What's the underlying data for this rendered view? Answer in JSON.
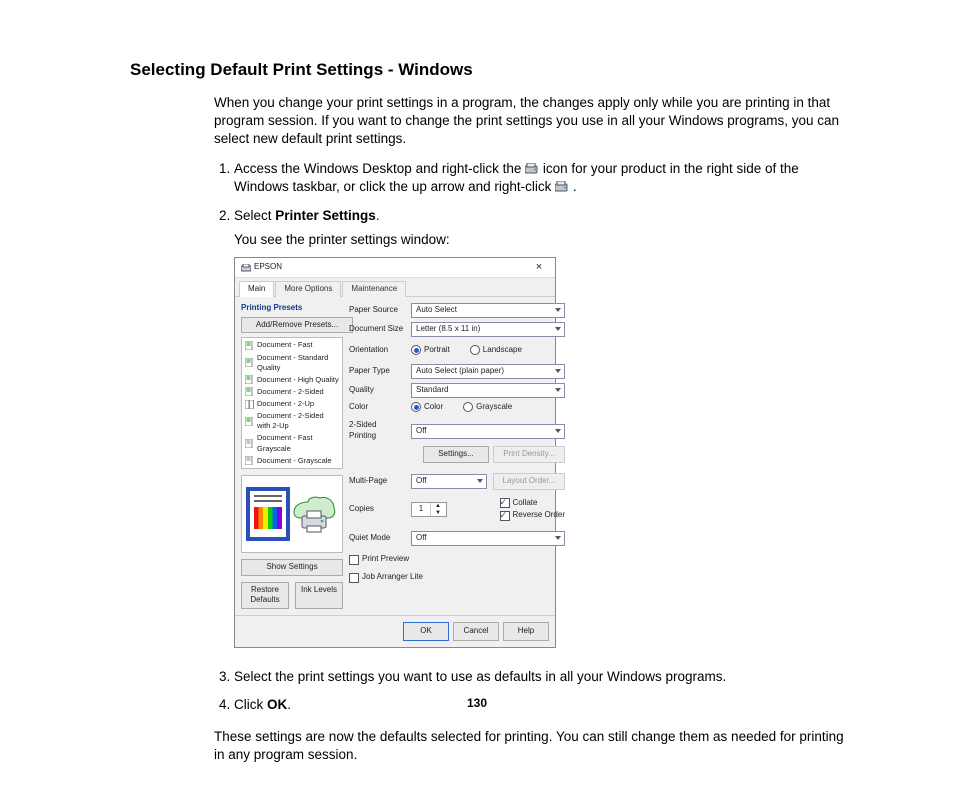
{
  "title": "Selecting Default Print Settings - Windows",
  "intro": "When you change your print settings in a program, the changes apply only while you are printing in that program session. If you want to change the print settings you use in all your Windows programs, you can select new default print settings.",
  "steps": {
    "s1a": "Access the Windows Desktop and right-click the ",
    "s1b": " icon for your product in the right side of the Windows taskbar, or click the up arrow and right-click ",
    "s1c": ".",
    "s1_sub": "",
    "s2a": "Select ",
    "s2b": "Printer Settings",
    "s2c": ".",
    "s2_sub": "You see the printer settings window:",
    "s3": "Select the print settings you want to use as defaults in all your Windows programs.",
    "s4a": "Click ",
    "s4b": "OK",
    "s4c": "."
  },
  "outro": "These settings are now the defaults selected for printing. You can still change them as needed for printing in any program session.",
  "page_num": "130",
  "dialog": {
    "title": "EPSON",
    "tabs": [
      "Main",
      "More Options",
      "Maintenance"
    ],
    "presets_title": "Printing Presets",
    "preset_button": "Add/Remove Presets...",
    "presets": [
      "Document - Fast",
      "Document - Standard Quality",
      "Document - High Quality",
      "Document - 2-Sided",
      "Document - 2-Up",
      "Document - 2-Sided with 2-Up",
      "Document - Fast Grayscale",
      "Document - Grayscale"
    ],
    "show_settings": "Show Settings",
    "restore_defaults": "Restore Defaults",
    "ink_levels": "Ink Levels",
    "labels": {
      "paper_source": "Paper Source",
      "document_size": "Document Size",
      "orientation": "Orientation",
      "paper_type": "Paper Type",
      "quality": "Quality",
      "color": "Color",
      "two_sided": "2-Sided Printing",
      "multi_page": "Multi-Page",
      "copies": "Copies",
      "quiet_mode": "Quiet Mode"
    },
    "values": {
      "paper_source": "Auto Select",
      "document_size": "Letter (8.5 x 11 in)",
      "orientation_portrait": "Portrait",
      "orientation_landscape": "Landscape",
      "paper_type": "Auto Select (plain paper)",
      "quality": "Standard",
      "color_color": "Color",
      "color_gray": "Grayscale",
      "two_sided": "Off",
      "multi_page": "Off",
      "copies": "1",
      "quiet_mode": "Off"
    },
    "buttons": {
      "settings": "Settings...",
      "print_density": "Print Density...",
      "layout_order": "Layout Order...",
      "collate": "Collate",
      "reverse": "Reverse Order",
      "print_preview": "Print Preview",
      "job_arranger": "Job Arranger Lite",
      "ok": "OK",
      "cancel": "Cancel",
      "help": "Help"
    }
  }
}
